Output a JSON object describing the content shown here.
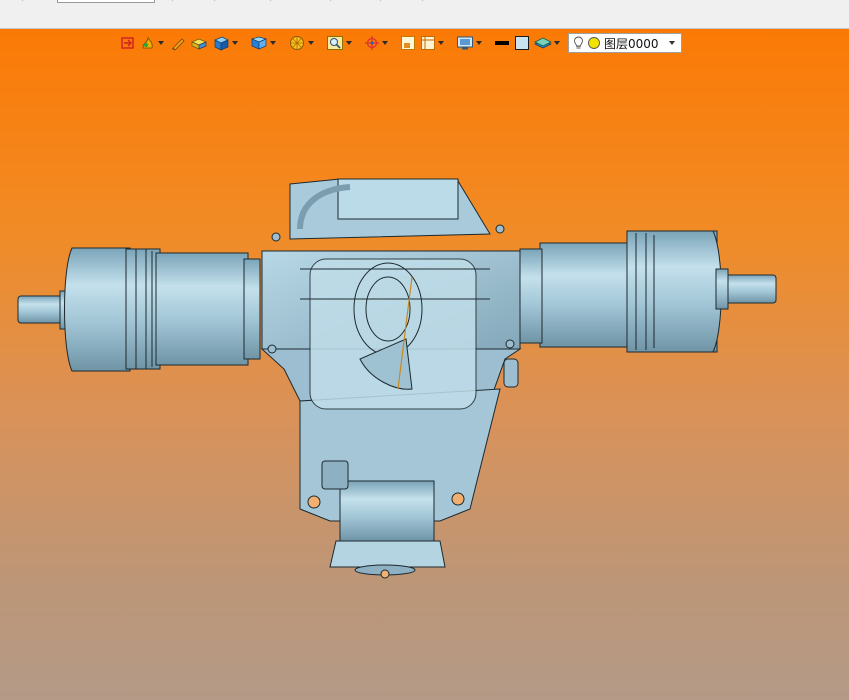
{
  "app": {
    "theme_colors": {
      "viewport_top": "#fb7a05",
      "viewport_bottom": "#b49a87",
      "part": "#9fc2d2",
      "edge": "#1c2a30"
    }
  },
  "toolbar": {
    "icons": [
      "zoom-refit-icon",
      "render-style-icon",
      "pencil-sketch-icon",
      "shaded-block-icon",
      "view-cube-icon",
      "named-view-icon",
      "section-wheel-icon",
      "zoom-window-icon",
      "spin-center-icon",
      "display-frame-icon",
      "saved-orientation-icon",
      "display-settings-icon",
      "black-line-swatch",
      "plain-swatch",
      "layer-plane-icon"
    ],
    "layer": {
      "label": "图层0000",
      "bulb_icon": "bulb-icon",
      "dot_color": "#f2e200"
    }
  }
}
